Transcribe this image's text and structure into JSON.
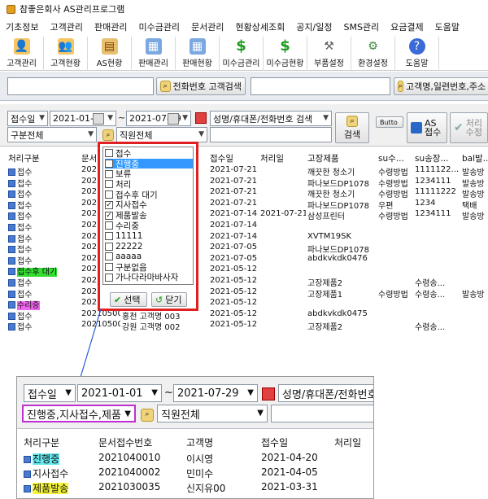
{
  "window": {
    "title": "참좋은회사 AS관리프로그램"
  },
  "menu": [
    "기초정보",
    "고객관리",
    "판매관리",
    "미수금관리",
    "문서관리",
    "현황상세조회",
    "공지/일정",
    "SMS관리",
    "요금결제",
    "도움말"
  ],
  "toolbar": [
    {
      "label": "고객관리",
      "icon": "customer-icon"
    },
    {
      "label": "고객현황",
      "icon": "customer-status-icon"
    },
    {
      "label": "AS현황",
      "icon": "clipboard-icon"
    },
    {
      "label": "판매관리",
      "icon": "sales-icon"
    },
    {
      "label": "판매현황",
      "icon": "sales-status-icon"
    },
    {
      "label": "미수금관리",
      "icon": "dollar-icon"
    },
    {
      "label": "미수금현황",
      "icon": "dollar-status-icon"
    },
    {
      "label": "부품설정",
      "icon": "parts-icon"
    },
    {
      "label": "환경설정",
      "icon": "gear-icon"
    },
    {
      "label": "도움말",
      "icon": "help-icon"
    }
  ],
  "search": {
    "phone_button": "전화번호 고객검색",
    "multi_button": "고객명,일련번호,주소"
  },
  "filters": {
    "date_type": "접수일",
    "date_from": "2021-01-01",
    "tilde": "~",
    "date_to": "2021-07-29",
    "search_field": "성명/휴대폰/전화번호 검색",
    "category": "구분전체",
    "staff": "직원전체",
    "search_button": "검색",
    "small_button": "Butto",
    "as_button": "AS 접수",
    "process_button": "처리 수정"
  },
  "grid": {
    "headers": [
      "처리구분",
      "문서",
      "",
      "접수일",
      "처리일",
      "고장제품",
      "su수...",
      "su송장...",
      "bal발..."
    ],
    "rows": [
      {
        "status": "접수",
        "doc": "202",
        "recv": "2021-07-21",
        "done": "",
        "product": "깨끗한 청소기",
        "su": "수령방법",
        "ship": "1111122...",
        "bal": "발송방"
      },
      {
        "status": "접수",
        "doc": "202",
        "recv": "2021-07-21",
        "done": "",
        "product": "파나보드DP1078",
        "su": "수령방법",
        "ship": "1234111",
        "bal": "발송방"
      },
      {
        "status": "접수",
        "doc": "202",
        "recv": "2021-07-21",
        "done": "",
        "product": "깨끗한 청소기",
        "su": "수령방법",
        "ship": "11111222",
        "bal": "발송방"
      },
      {
        "status": "접수",
        "doc": "202",
        "recv": "2021-07-21",
        "done": "",
        "product": "파나보드DP1078",
        "su": "우편",
        "ship": "1234",
        "bal": "택배"
      },
      {
        "status": "접수",
        "doc": "202",
        "recv": "2021-07-14",
        "done": "2021-07-21",
        "product": "삼성프린터",
        "su": "수령방법",
        "ship": "1234111",
        "bal": "발송방"
      },
      {
        "status": "접수",
        "doc": "202",
        "recv": "2021-07-14",
        "done": "",
        "product": "",
        "su": "",
        "ship": "",
        "bal": ""
      },
      {
        "status": "접수",
        "doc": "202",
        "recv": "2021-07-14",
        "done": "",
        "product": "XVTM19SK",
        "su": "",
        "ship": "",
        "bal": ""
      },
      {
        "status": "접수",
        "doc": "202",
        "recv": "2021-07-05",
        "done": "",
        "product": "파나보드DP1078",
        "su": "",
        "ship": "",
        "bal": ""
      },
      {
        "status": "접수",
        "doc": "202",
        "recv": "2021-07-05",
        "done": "",
        "product": "abdkvkdk0476",
        "su": "",
        "ship": "",
        "bal": ""
      },
      {
        "status": "접수후 대기",
        "doc": "202",
        "recv": "2021-05-12",
        "done": "",
        "product": "",
        "su": "",
        "ship": "",
        "bal": ""
      },
      {
        "status": "접수",
        "doc": "202",
        "recv": "2021-05-12",
        "done": "",
        "product": "고장제품2",
        "su": "",
        "ship": "수령송...",
        "bal": ""
      },
      {
        "status": "접수",
        "doc": "202",
        "recv": "2021-05-12",
        "done": "",
        "product": "고장제품1",
        "su": "수령방법",
        "ship": "수령송...",
        "bal": "발송방"
      },
      {
        "status": "수리중",
        "doc": "202",
        "recv": "2021-05-12",
        "done": "",
        "product": "",
        "su": "",
        "ship": "",
        "bal": ""
      },
      {
        "status": "접수",
        "doc": "2021050003",
        "extra": "홍천 고객명 003",
        "recv": "2021-05-12",
        "done": "",
        "product": "abdkvkdk0475",
        "su": "",
        "ship": "",
        "bal": ""
      },
      {
        "status": "접수",
        "doc": "2021050002",
        "extra": "강원 고객명 002",
        "recv": "2021-05-12",
        "done": "",
        "product": "고장제품2",
        "su": "",
        "ship": "수령송...",
        "bal": ""
      }
    ]
  },
  "popup": {
    "options": [
      {
        "label": "접수",
        "checked": false
      },
      {
        "label": "진행중",
        "checked": true,
        "selected": true
      },
      {
        "label": "보류",
        "checked": false
      },
      {
        "label": "처리",
        "checked": false
      },
      {
        "label": "접수후 대기",
        "checked": false
      },
      {
        "label": "지사접수",
        "checked": true
      },
      {
        "label": "제품발송",
        "checked": true
      },
      {
        "label": "수리중",
        "checked": false
      },
      {
        "label": "11111",
        "checked": false
      },
      {
        "label": "22222",
        "checked": false
      },
      {
        "label": "aaaaa",
        "checked": false
      },
      {
        "label": "구분없음",
        "checked": false
      },
      {
        "label": "가나다라마바사자",
        "checked": false
      }
    ],
    "select_button": "선택",
    "close_button": "닫기",
    "check_mark": "✓"
  },
  "inset": {
    "date_type": "접수일",
    "date_from": "2021-01-01",
    "tilde": "~",
    "date_to": "2021-07-29",
    "search_field": "성명/휴대폰/전화번호 검",
    "category": "진행중,지사접수,제품",
    "staff": "직원전체",
    "headers": [
      "처리구분",
      "문서접수번호",
      "고객명",
      "접수일",
      "처리일"
    ],
    "rows": [
      {
        "status": "진행중",
        "doc": "2021040010",
        "name": "이시영",
        "recv": "2021-04-20"
      },
      {
        "status": "지사접수",
        "doc": "2021040002",
        "name": "민미수",
        "recv": "2021-04-05"
      },
      {
        "status": "제품발송",
        "doc": "2021030035",
        "name": "신지유00",
        "recv": "2021-03-31"
      }
    ]
  },
  "colors": {
    "highlight_red": "#e02020",
    "highlight_magenta": "#c030d0",
    "arrow_blue": "#2a5bd7",
    "status_waiting": "#33dd33",
    "status_repair": "#ee66ee",
    "status_inprogress": "#66e8ee",
    "status_shipped": "#f5f53a",
    "select_blue": "#3399ff"
  }
}
